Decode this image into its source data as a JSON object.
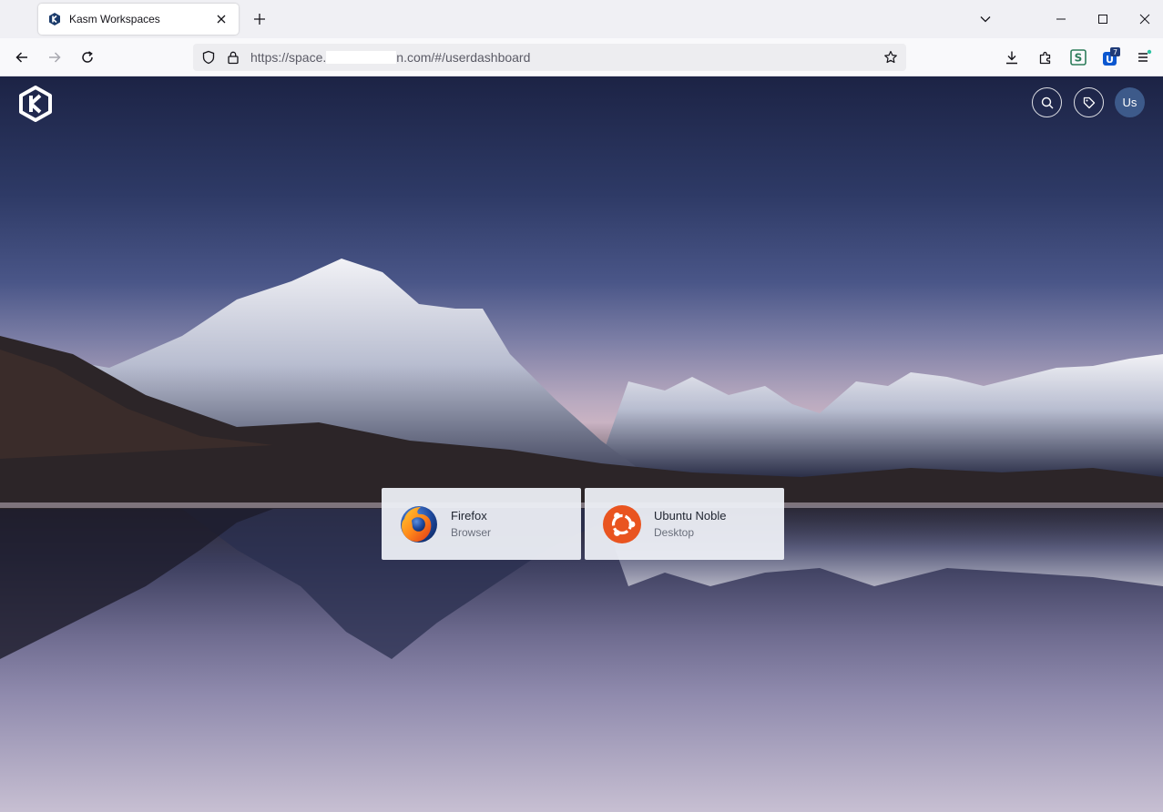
{
  "tab": {
    "title": "Kasm Workspaces"
  },
  "address_bar": {
    "url_prefix": "https://space.",
    "url_suffix": "n.com/#/userdashboard"
  },
  "extensions": {
    "badge_count": "7"
  },
  "header": {
    "avatar_initials": "Us"
  },
  "workspaces": [
    {
      "title": "Firefox",
      "subtitle": "Browser",
      "icon": "firefox-icon"
    },
    {
      "title": "Ubuntu Noble",
      "subtitle": "Desktop",
      "icon": "ubuntu-icon"
    }
  ],
  "colors": {
    "avatar": "#3d5a8a",
    "ubuntu": "#e95420",
    "accent": "#0060df"
  }
}
